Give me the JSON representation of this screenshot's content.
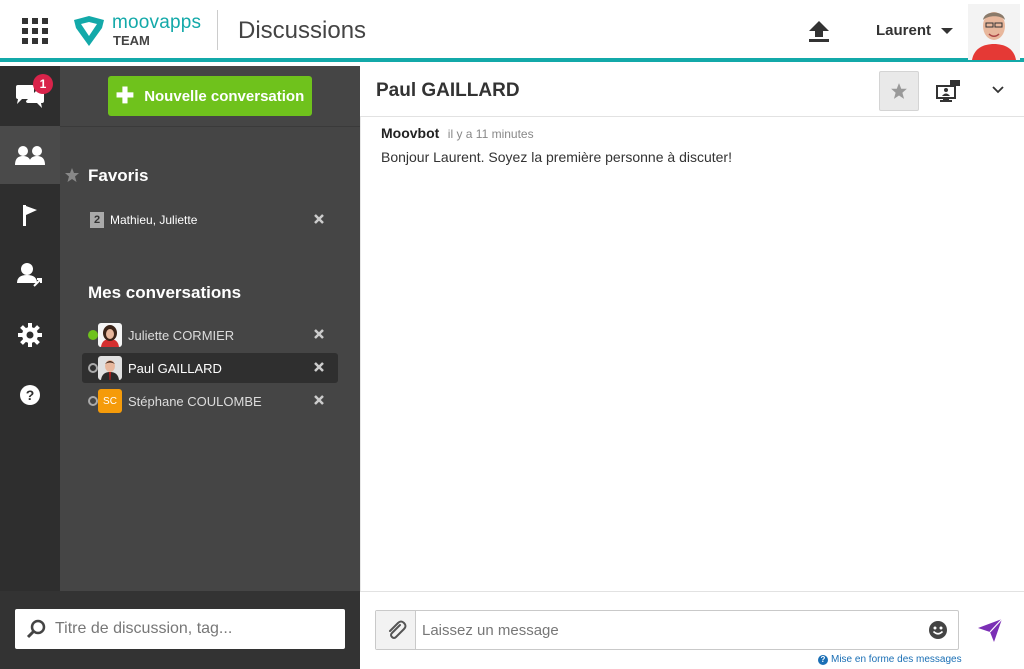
{
  "header": {
    "logo_name": "moovapps",
    "logo_sub": "TEAM",
    "app_title": "Discussions",
    "user_name": "Laurent",
    "brand_color": "#13a9a9"
  },
  "iconbar": {
    "items": [
      {
        "icon": "chat-bubbles-icon",
        "badge": "1"
      },
      {
        "icon": "contacts-icon",
        "active": true
      },
      {
        "icon": "flag-icon"
      },
      {
        "icon": "user-share-icon"
      },
      {
        "icon": "gear-icon"
      },
      {
        "icon": "help-icon"
      }
    ]
  },
  "list": {
    "new_conversation_label": "Nouvelle conversation",
    "favorites_title": "Favoris",
    "favorites": [
      {
        "count": "2",
        "name": "Mathieu, Juliette"
      }
    ],
    "my_conversations_title": "Mes conversations",
    "conversations": [
      {
        "name": "Juliette CORMIER",
        "status": "online"
      },
      {
        "name": "Paul GAILLARD",
        "status": "offline",
        "selected": true
      },
      {
        "name": "Stéphane COULOMBE",
        "status": "offline",
        "initials": "SC"
      }
    ],
    "search_placeholder": "Titre de discussion, tag..."
  },
  "chat": {
    "title": "Paul GAILLARD",
    "messages": [
      {
        "author": "Moovbot",
        "time": "il y a 11 minutes",
        "text": "Bonjour Laurent. Soyez la première personne à discuter!"
      }
    ],
    "composer_placeholder": "Laissez un message",
    "format_link": "Mise en forme des messages",
    "send_color": "#7b2fb5"
  }
}
